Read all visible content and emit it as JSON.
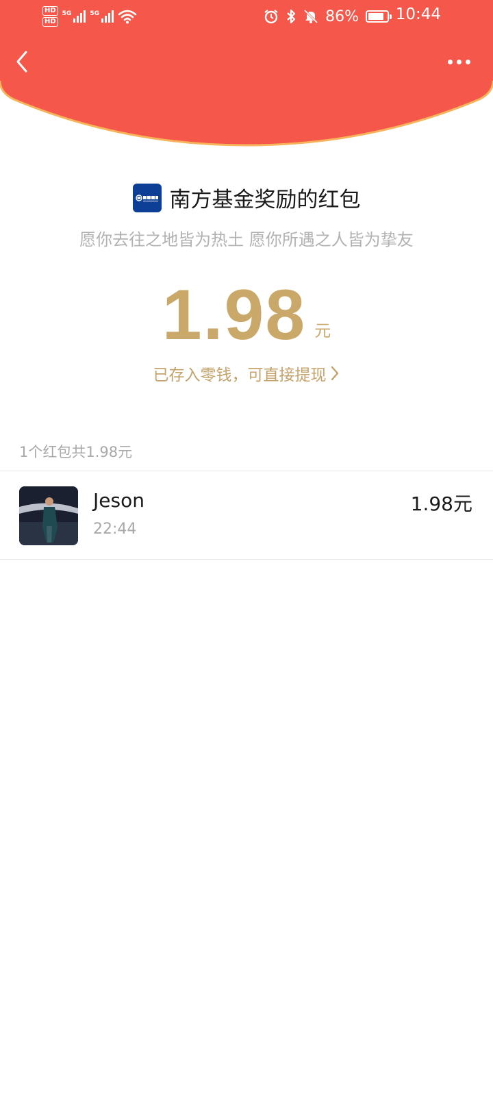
{
  "status_bar": {
    "hd_badges": [
      "HD",
      "HD"
    ],
    "network_1": "5G",
    "network_2": "5G",
    "battery_percent": "86%",
    "battery_level": 0.86,
    "time": "10:44",
    "icons": [
      "alarm-icon",
      "bluetooth-icon",
      "mute-icon",
      "battery-icon",
      "wifi-icon"
    ]
  },
  "header": {
    "background_color": "#f5574a",
    "edge_color": "#f7b45a",
    "back_icon": "chevron-left-icon",
    "more_icon": "more-dots-icon"
  },
  "sender": {
    "logo_icon": "fund-logo-icon",
    "title": "南方基金奖励的红包"
  },
  "blessing": "愿你去往之地皆为热土 愿你所遇之人皆为挚友",
  "amount": {
    "value": "1.98",
    "unit": "元",
    "color": "#c9a86a"
  },
  "saved_link": {
    "text": "已存入零钱，可直接提现",
    "icon": "chevron-right-icon"
  },
  "summary": "1个红包共1.98元",
  "records": [
    {
      "name": "Jeson",
      "time": "22:44",
      "amount": "1.98元"
    }
  ]
}
